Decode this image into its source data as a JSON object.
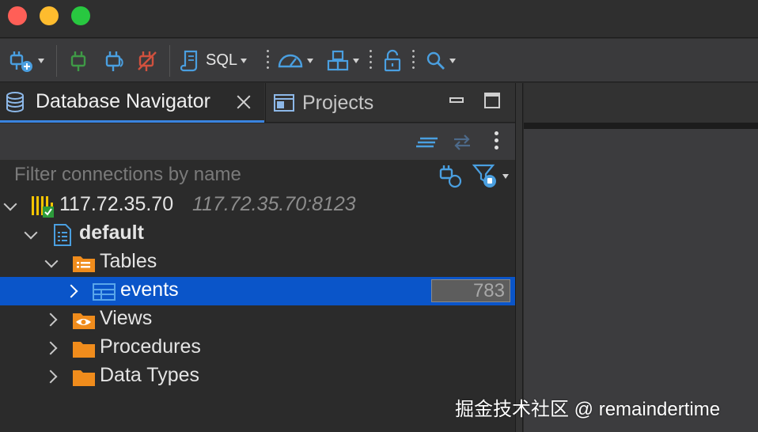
{
  "toolbar": {
    "new_connection_icon": "plug-add-icon",
    "connect_icon": "plug-connect-icon",
    "reconnect_icon": "plug-reconnect-icon",
    "disconnect_icon": "plug-disconnect-icon",
    "sql_label": "SQL",
    "dashboard_icon": "gauge-icon",
    "deploy_icon": "boxes-icon",
    "lock_icon": "lock-icon",
    "search_icon": "search-icon"
  },
  "tabs": [
    {
      "label": "Database Navigator",
      "icon": "database-icon",
      "active": true
    },
    {
      "label": "Projects",
      "icon": "projects-icon",
      "active": false
    }
  ],
  "filter": {
    "placeholder": "Filter connections by name"
  },
  "tree": {
    "connection": {
      "label": "117.72.35.70",
      "address": "117.72.35.70:8123",
      "icon": "clickhouse-icon"
    },
    "database": {
      "label": "default",
      "icon": "database-doc-icon"
    },
    "tables_folder": {
      "label": "Tables",
      "icon": "tables-folder-icon"
    },
    "events_table": {
      "label": "events",
      "row_count": "783",
      "icon": "table-icon"
    },
    "views_folder": {
      "label": "Views",
      "icon": "eye-folder-icon"
    },
    "procedures_folder": {
      "label": "Procedures",
      "icon": "folder-icon"
    },
    "datatypes_folder": {
      "label": "Data Types",
      "icon": "folder-icon"
    }
  },
  "watermark": "掘金技术社区 @ remaindertime",
  "colors": {
    "selection": "#0a55c9",
    "active_tab_underline": "#3a84e0",
    "folder": "#f08c1c",
    "icon_blue": "#4a9fe0",
    "connect_green": "#3f9a46",
    "disconnect_red": "#d0513e"
  }
}
